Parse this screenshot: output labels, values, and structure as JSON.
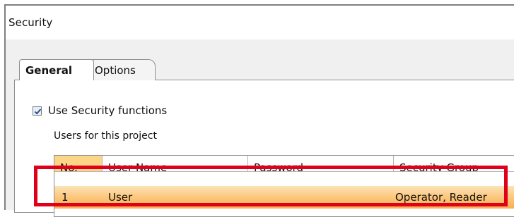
{
  "window": {
    "title": "Security"
  },
  "tabs": [
    {
      "label": "General",
      "active": true
    },
    {
      "label": "Options",
      "active": false
    }
  ],
  "security": {
    "checkbox_label": "Use Security functions",
    "checked": true,
    "users_label": "Users for this project"
  },
  "grid": {
    "columns": [
      "No.",
      "User Name",
      "Password",
      "Security Group"
    ],
    "rows": [
      {
        "no": "1",
        "user_name": "User",
        "password": "",
        "security_group": "Operator, Reader"
      }
    ]
  },
  "colors": {
    "highlight_border": "#e0001a",
    "selected_row": "#fbc577",
    "header_accent": "#fbd689"
  }
}
